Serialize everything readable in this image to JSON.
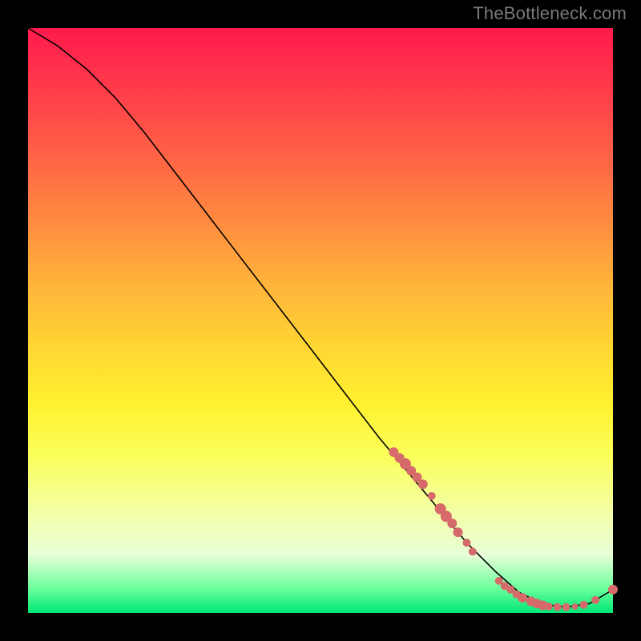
{
  "attribution": "TheBottleneck.com",
  "colors": {
    "background": "#000000",
    "gradient_top": "#ff1a4d",
    "gradient_mid": "#ffd733",
    "gradient_bottom": "#00e676",
    "curve": "#000000",
    "marker": "#d66a6a"
  },
  "chart_data": {
    "type": "line",
    "title": "",
    "xlabel": "",
    "ylabel": "",
    "xlim": [
      0,
      100
    ],
    "ylim": [
      0,
      100
    ],
    "series": [
      {
        "name": "curve",
        "x": [
          0,
          5,
          10,
          15,
          20,
          25,
          30,
          35,
          40,
          45,
          50,
          55,
          60,
          65,
          70,
          75,
          80,
          84,
          88,
          92,
          96,
          100
        ],
        "y": [
          100,
          97,
          93,
          88,
          82,
          75.5,
          69,
          62.5,
          56,
          49.5,
          43,
          36.5,
          30,
          24,
          18,
          12,
          7,
          3.5,
          1.5,
          1,
          1.6,
          4
        ]
      }
    ],
    "markers": {
      "name": "dots",
      "points": [
        {
          "x": 62.5,
          "y": 27.5,
          "r": 6
        },
        {
          "x": 63.5,
          "y": 26.5,
          "r": 6
        },
        {
          "x": 64.5,
          "y": 25.5,
          "r": 7
        },
        {
          "x": 65.5,
          "y": 24.3,
          "r": 6
        },
        {
          "x": 66.5,
          "y": 23.2,
          "r": 6
        },
        {
          "x": 67.5,
          "y": 22.0,
          "r": 6
        },
        {
          "x": 69.0,
          "y": 20.0,
          "r": 5
        },
        {
          "x": 70.5,
          "y": 17.8,
          "r": 7
        },
        {
          "x": 71.5,
          "y": 16.5,
          "r": 7
        },
        {
          "x": 72.5,
          "y": 15.3,
          "r": 6
        },
        {
          "x": 73.5,
          "y": 13.8,
          "r": 6
        },
        {
          "x": 75.0,
          "y": 12.0,
          "r": 5
        },
        {
          "x": 76.0,
          "y": 10.5,
          "r": 5
        },
        {
          "x": 80.5,
          "y": 5.5,
          "r": 5
        },
        {
          "x": 81.5,
          "y": 4.6,
          "r": 5
        },
        {
          "x": 82.5,
          "y": 4.0,
          "r": 5
        },
        {
          "x": 83.5,
          "y": 3.2,
          "r": 5
        },
        {
          "x": 84.5,
          "y": 2.6,
          "r": 6
        },
        {
          "x": 86.0,
          "y": 2.0,
          "r": 6
        },
        {
          "x": 87.0,
          "y": 1.6,
          "r": 6
        },
        {
          "x": 88.0,
          "y": 1.3,
          "r": 6
        },
        {
          "x": 89.0,
          "y": 1.1,
          "r": 5
        },
        {
          "x": 90.5,
          "y": 1.0,
          "r": 5
        },
        {
          "x": 92.0,
          "y": 1.0,
          "r": 5
        },
        {
          "x": 93.5,
          "y": 1.1,
          "r": 4
        },
        {
          "x": 95.0,
          "y": 1.4,
          "r": 5
        },
        {
          "x": 97.0,
          "y": 2.2,
          "r": 5
        },
        {
          "x": 100,
          "y": 4.0,
          "r": 6
        }
      ]
    }
  }
}
